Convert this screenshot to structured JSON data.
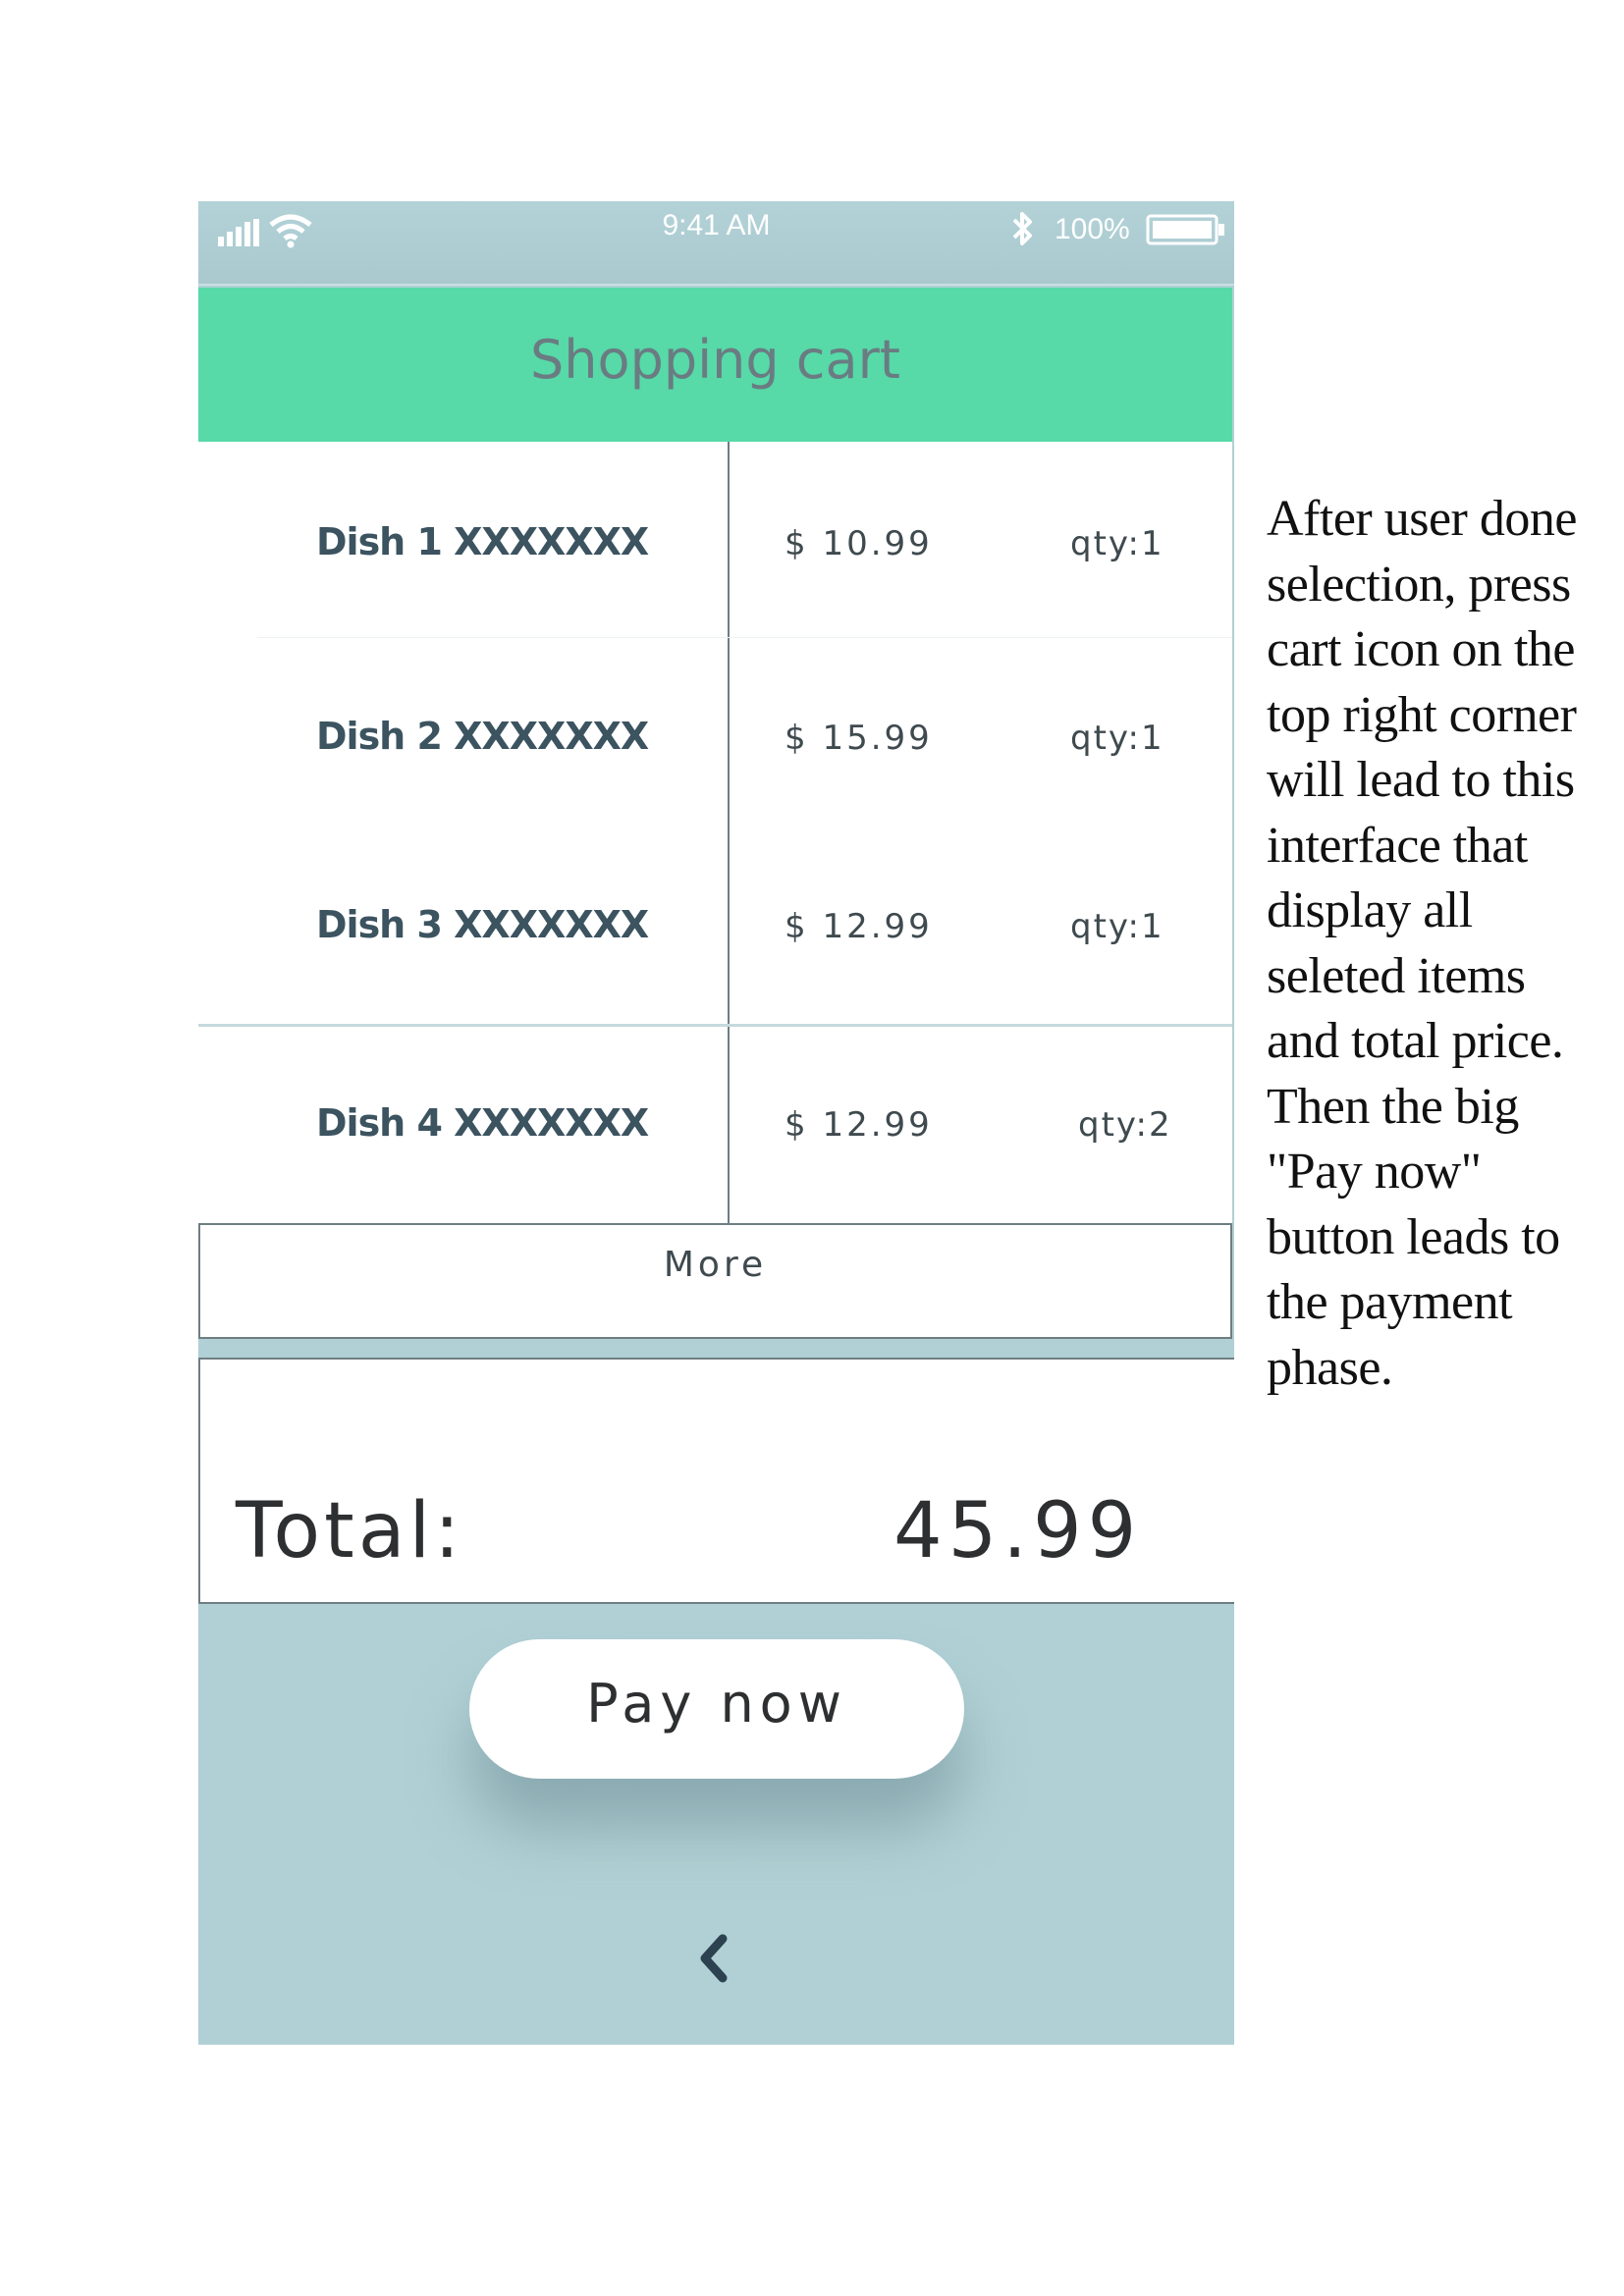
{
  "status_bar": {
    "time": "9:41 AM",
    "battery": "100%",
    "icons": [
      "signal-icon",
      "wifi-icon",
      "bluetooth-icon",
      "battery-icon"
    ]
  },
  "header": {
    "title": "Shopping cart"
  },
  "cart": {
    "items": [
      {
        "name": "Dish 1 XXXXXXX",
        "price": "$ 10.99",
        "qty": "qty:1"
      },
      {
        "name": "Dish 2 XXXXXXX",
        "price": "$ 15.99",
        "qty": "qty:1"
      },
      {
        "name": "Dish 3 XXXXXXX",
        "price": "$ 12.99",
        "qty": "qty:1"
      },
      {
        "name": "Dish 4 XXXXXXX",
        "price": "$ 12.99",
        "qty": "qty:2"
      }
    ],
    "more_label": "More"
  },
  "total": {
    "label": "Total:",
    "value": "45.99"
  },
  "actions": {
    "pay_label": "Pay now",
    "back_icon": "chevron-left-icon"
  },
  "annotation": {
    "lines": [
      "After user done",
      "selection, press",
      "cart icon on the",
      "top right corner",
      "will lead to this",
      "interface that",
      "display all",
      "seleted items",
      "and total price.",
      "Then the big",
      "\"Pay now\"",
      "button leads to",
      "the payment",
      "phase."
    ]
  },
  "colors": {
    "header": "#57d9a8",
    "background": "#b0d0d5",
    "dish_text": "#3c5360"
  }
}
